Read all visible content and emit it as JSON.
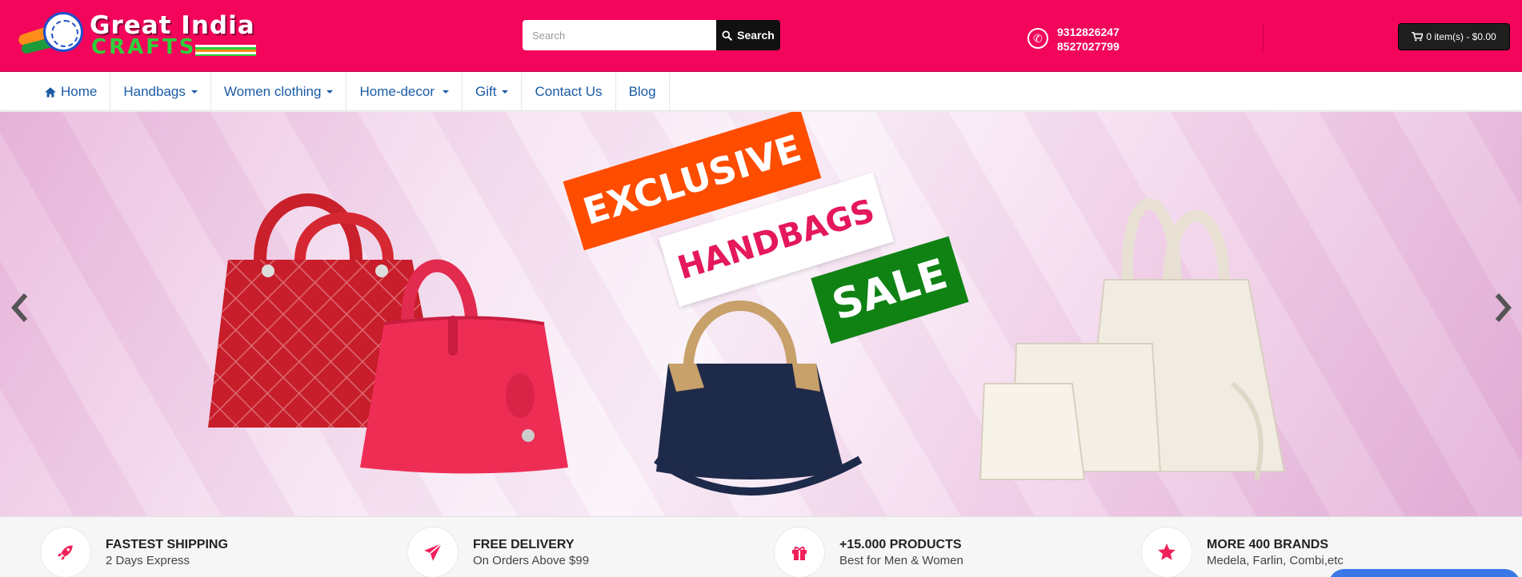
{
  "header": {
    "logo": {
      "line1": "Great India",
      "line2": "CRAFTS"
    },
    "search": {
      "placeholder": "Search",
      "button_label": "Search"
    },
    "phones": [
      "9312826247",
      "8527027799"
    ],
    "cart_label": "0 item(s) - $0.00",
    "brand_color": "#f3055c"
  },
  "nav": {
    "items": [
      {
        "label": "Home",
        "icon": "home-icon",
        "dropdown": false
      },
      {
        "label": "Handbags",
        "dropdown": true
      },
      {
        "label": "Women clothing",
        "dropdown": true
      },
      {
        "label": "Home-decor",
        "dropdown": true
      },
      {
        "label": "Gift",
        "dropdown": true
      },
      {
        "label": "Contact Us",
        "dropdown": false
      },
      {
        "label": "Blog",
        "dropdown": false
      }
    ]
  },
  "banner": {
    "labels": [
      "EXCLUSIVE",
      "HANDBAGS",
      "SALE"
    ],
    "colors": {
      "exclusive": "#ff4d00",
      "handbags_text": "#e4185a",
      "sale": "#108214"
    }
  },
  "features": [
    {
      "title": "FASTEST SHIPPING",
      "subtitle": "2 Days Express",
      "icon": "rocket-icon"
    },
    {
      "title": "FREE DELIVERY",
      "subtitle": "On Orders Above $99",
      "icon": "paper-plane-icon"
    },
    {
      "title": "+15.000 PRODUCTS",
      "subtitle": "Best for Men & Women",
      "icon": "gift-icon"
    },
    {
      "title": "MORE 400 BRANDS",
      "subtitle": "Medela, Farlin, Combi,etc",
      "icon": "star-icon"
    }
  ]
}
